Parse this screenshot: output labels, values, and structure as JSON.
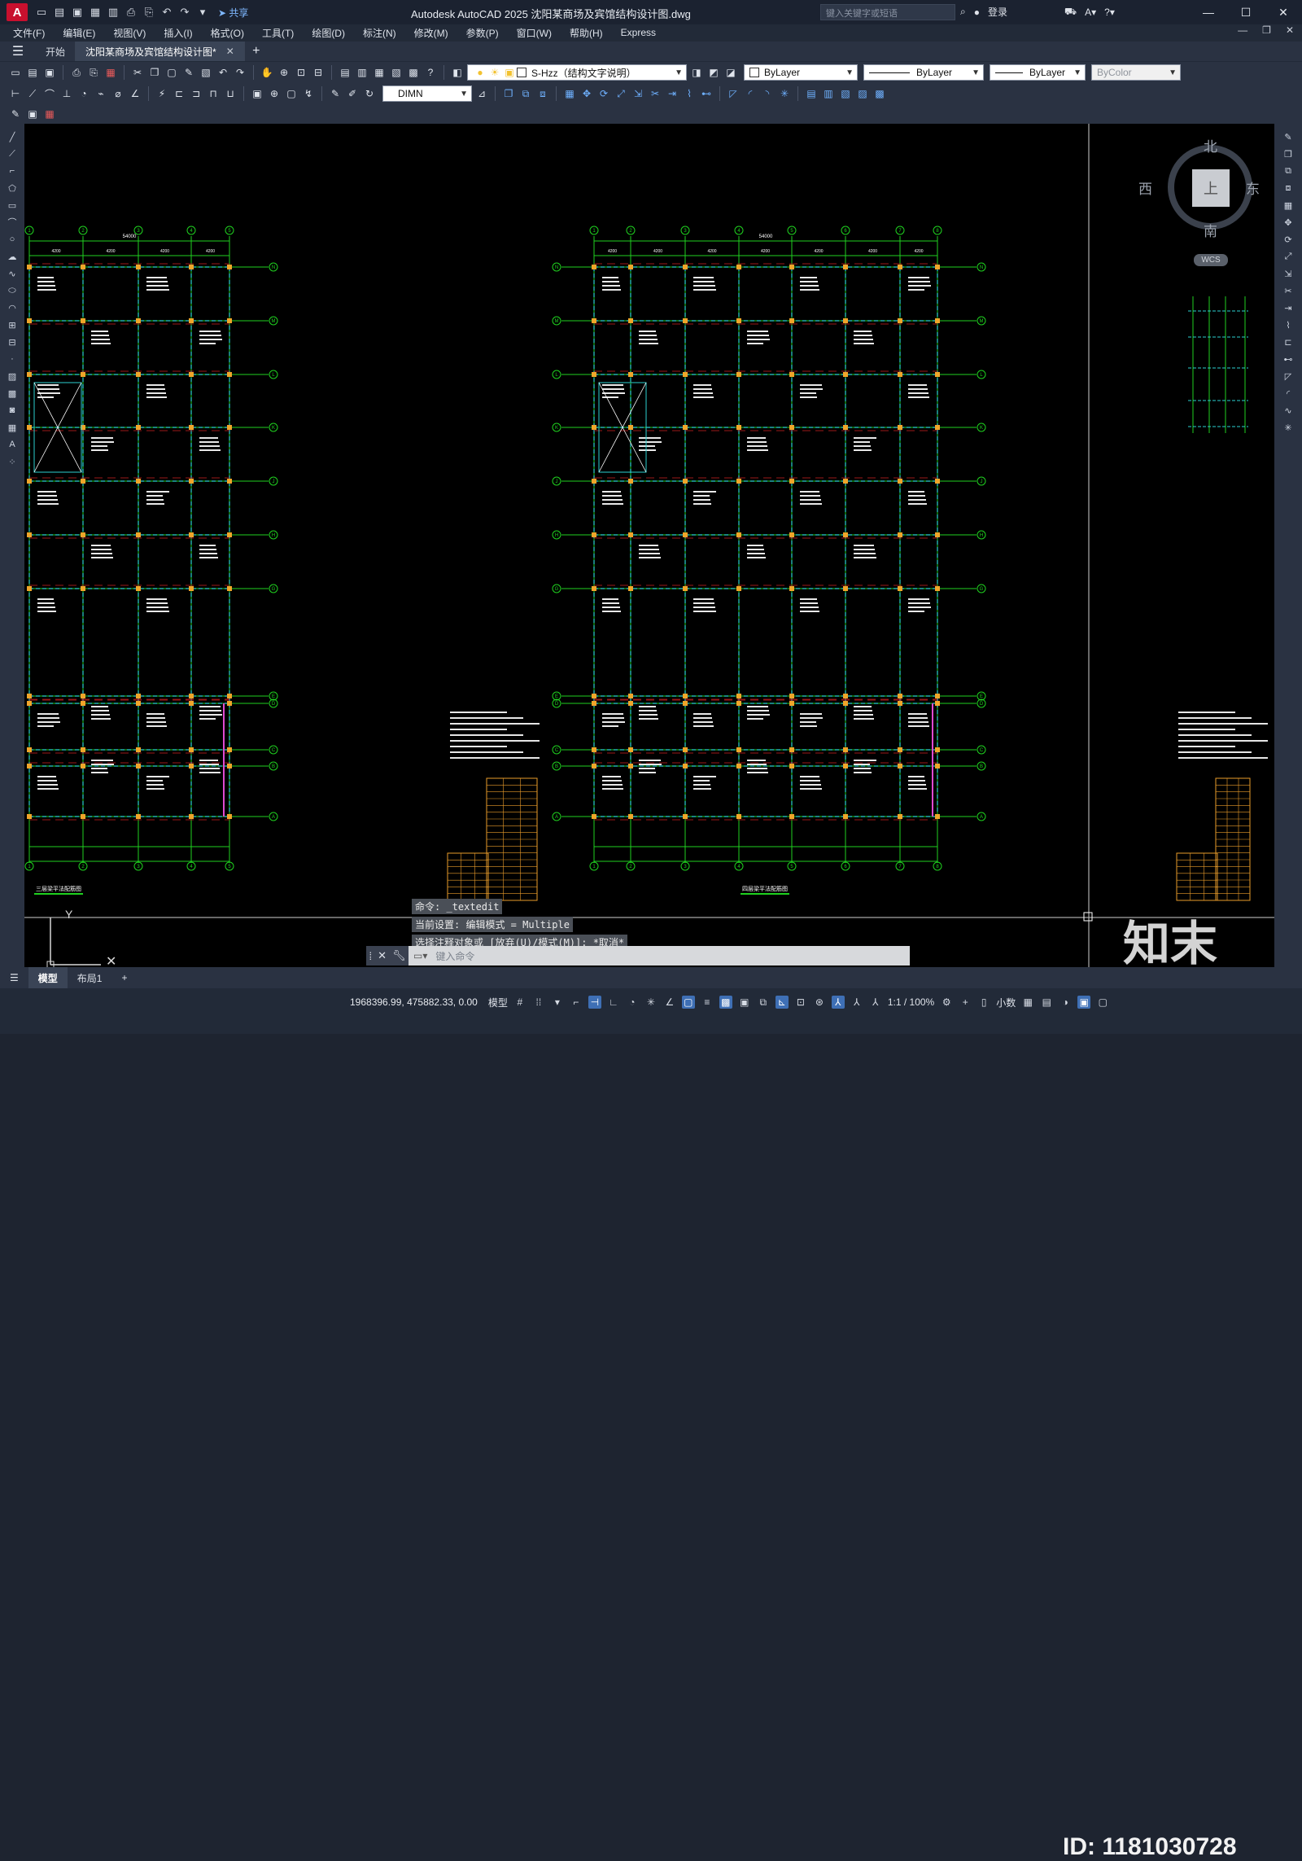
{
  "app": {
    "logo": "A",
    "title": "Autodesk AutoCAD 2025    沈阳某商场及宾馆结构设计图.dwg",
    "share_label": "共享",
    "search_placeholder": "键入关键字或短语",
    "login_label": "登录"
  },
  "menu": [
    "文件(F)",
    "编辑(E)",
    "视图(V)",
    "插入(I)",
    "格式(O)",
    "工具(T)",
    "绘图(D)",
    "标注(N)",
    "修改(M)",
    "参数(P)",
    "窗口(W)",
    "帮助(H)",
    "Express"
  ],
  "file_tabs": {
    "start": "开始",
    "active": "沈阳某商场及宾馆结构设计图*"
  },
  "properties": {
    "layer": "S-Hzz（结构文字说明）",
    "color": "ByLayer",
    "linetype": "ByLayer",
    "lineweight": "ByLayer",
    "plotstyle": "ByColor",
    "dimstyle": "DIMN"
  },
  "viewcube": {
    "north": "北",
    "south": "南",
    "east": "东",
    "west": "西",
    "face": "上",
    "wcs": "WCS"
  },
  "drawing": {
    "plan_left_title": "三层梁平法配筋图",
    "plan_mid_title": "四层梁平法配筋图",
    "axis_letters": [
      "N",
      "M",
      "L",
      "K",
      "J",
      "H",
      "G",
      "E",
      "D",
      "C",
      "B",
      "A"
    ],
    "axis_numbers": [
      "1",
      "2",
      "3",
      "4",
      "5",
      "6",
      "7",
      "8"
    ],
    "total_dim": "54000",
    "ucs_y": "Y"
  },
  "command": {
    "history": [
      "命令: _textedit",
      "当前设置: 编辑模式 = Multiple",
      "选择注释对象或 [放弃(U)/模式(M)]: *取消*"
    ],
    "placeholder": "键入命令"
  },
  "layout_tabs": [
    "模型",
    "布局1"
  ],
  "status": {
    "coords": "1968396.99, 475882.33, 0.00",
    "model": "模型",
    "scale": "1:1 / 100%",
    "units": "小数"
  },
  "watermark": {
    "logo": "知末",
    "id": "ID: 1181030728"
  }
}
